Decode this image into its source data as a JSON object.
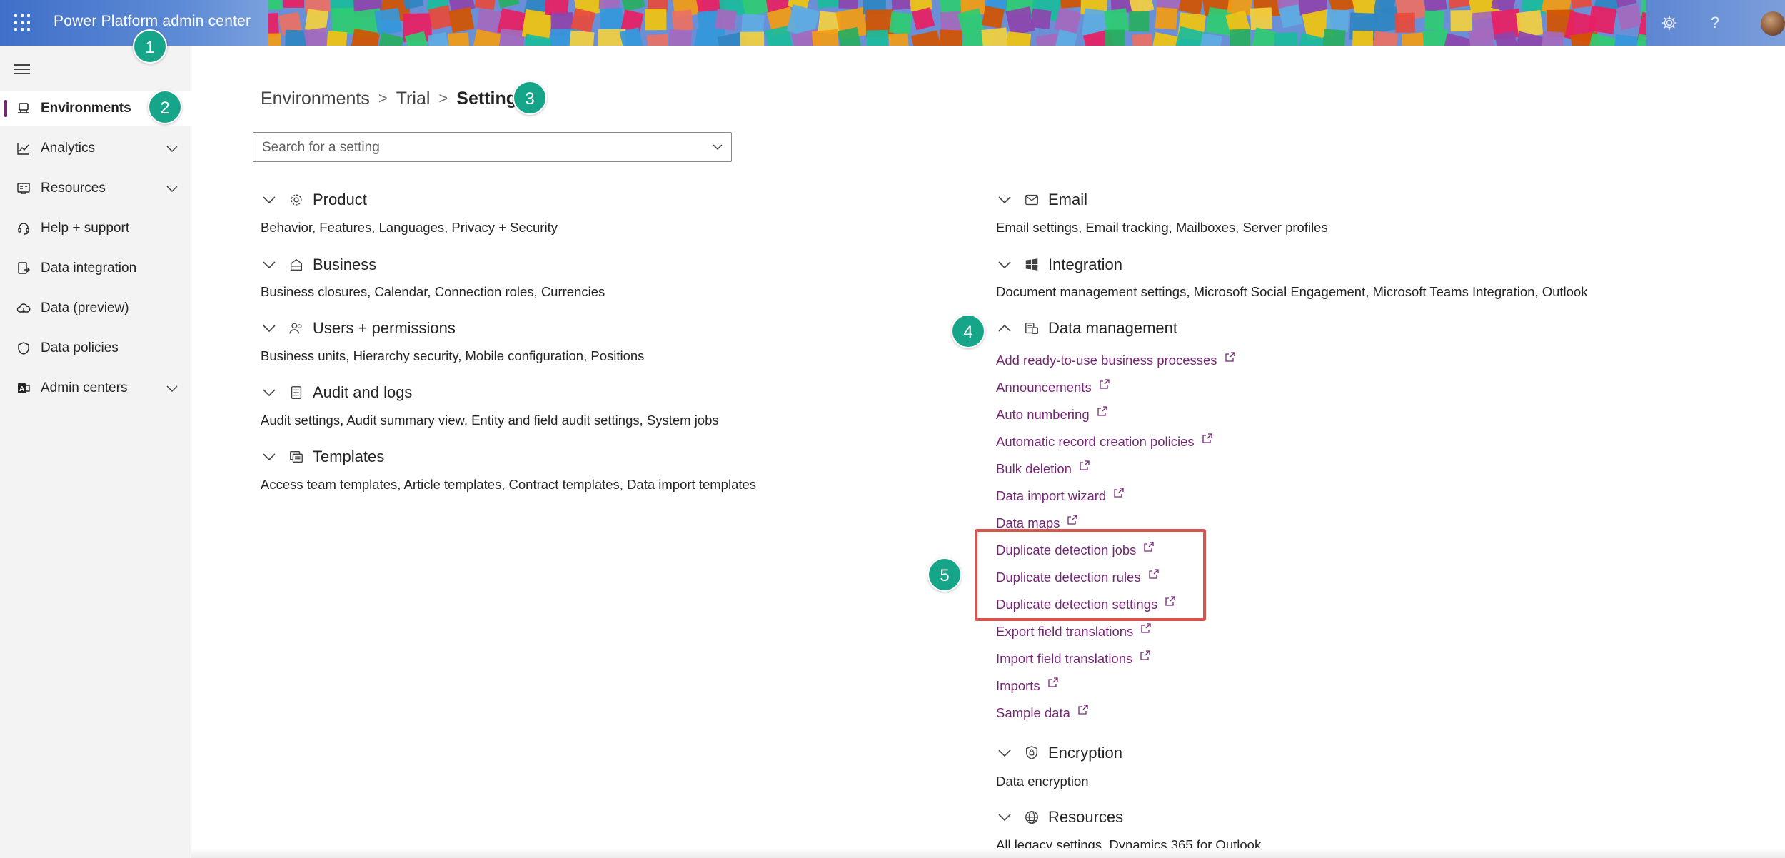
{
  "header": {
    "app_title": "Power Platform admin center",
    "icons": [
      "waffle-icon",
      "gear-icon",
      "help-icon",
      "avatar"
    ],
    "help_glyph": "?",
    "brand_color": "#5f8cd6"
  },
  "sidebar": {
    "items": [
      {
        "label": "Environments",
        "icon": "environments-icon",
        "active": true,
        "expandable": false
      },
      {
        "label": "Analytics",
        "icon": "analytics-icon",
        "active": false,
        "expandable": true
      },
      {
        "label": "Resources",
        "icon": "resources-icon",
        "active": false,
        "expandable": true
      },
      {
        "label": "Help + support",
        "icon": "headset-icon",
        "active": false,
        "expandable": false
      },
      {
        "label": "Data integration",
        "icon": "data-integration-icon",
        "active": false,
        "expandable": false
      },
      {
        "label": "Data (preview)",
        "icon": "cloud-icon",
        "active": false,
        "expandable": false
      },
      {
        "label": "Data policies",
        "icon": "shield-icon",
        "active": false,
        "expandable": false
      },
      {
        "label": "Admin centers",
        "icon": "admin-centers-icon",
        "active": false,
        "expandable": true
      }
    ],
    "active_color": "#742774"
  },
  "breadcrumb": {
    "items": [
      "Environments",
      "Trial"
    ],
    "current": "Settings",
    "separator": ">"
  },
  "search": {
    "placeholder": "Search for a setting",
    "value": ""
  },
  "groups_left": [
    {
      "title": "Product",
      "icon": "gear-icon",
      "expanded": false,
      "desc": "Behavior, Features, Languages, Privacy + Security"
    },
    {
      "title": "Business",
      "icon": "business-icon",
      "expanded": false,
      "desc": "Business closures, Calendar, Connection roles, Currencies"
    },
    {
      "title": "Users + permissions",
      "icon": "people-icon",
      "expanded": false,
      "desc": "Business units, Hierarchy security, Mobile configuration, Positions"
    },
    {
      "title": "Audit and logs",
      "icon": "document-icon",
      "expanded": false,
      "desc": "Audit settings, Audit summary view, Entity and field audit settings, System jobs"
    },
    {
      "title": "Templates",
      "icon": "templates-icon",
      "expanded": false,
      "desc": "Access team templates, Article templates, Contract templates, Data import templates"
    }
  ],
  "groups_right": [
    {
      "title": "Email",
      "icon": "mail-icon",
      "expanded": false,
      "desc": "Email settings, Email tracking, Mailboxes, Server profiles"
    },
    {
      "title": "Integration",
      "icon": "windows-icon",
      "expanded": false,
      "desc": "Document management settings, Microsoft Social Engagement, Microsoft Teams Integration, Outlook"
    },
    {
      "title": "Data management",
      "icon": "data-management-icon",
      "expanded": true,
      "desc": ""
    },
    {
      "title": "Encryption",
      "icon": "encryption-icon",
      "expanded": false,
      "desc": "Data encryption"
    },
    {
      "title": "Resources",
      "icon": "globe-icon",
      "expanded": false,
      "desc": "All legacy settings, Dynamics 365 for Outlook"
    }
  ],
  "data_management_links": [
    "Add ready-to-use business processes",
    "Announcements",
    "Auto numbering",
    "Automatic record creation policies",
    "Bulk deletion",
    "Data import wizard",
    "Data maps",
    "Duplicate detection jobs",
    "Duplicate detection rules",
    "Duplicate detection settings",
    "Export field translations",
    "Import field translations",
    "Imports",
    "Sample data"
  ],
  "callouts": [
    "1",
    "2",
    "3",
    "4",
    "5"
  ],
  "highlight_color": "#d9534f",
  "callout_color": "#17a589",
  "link_color": "#742774"
}
